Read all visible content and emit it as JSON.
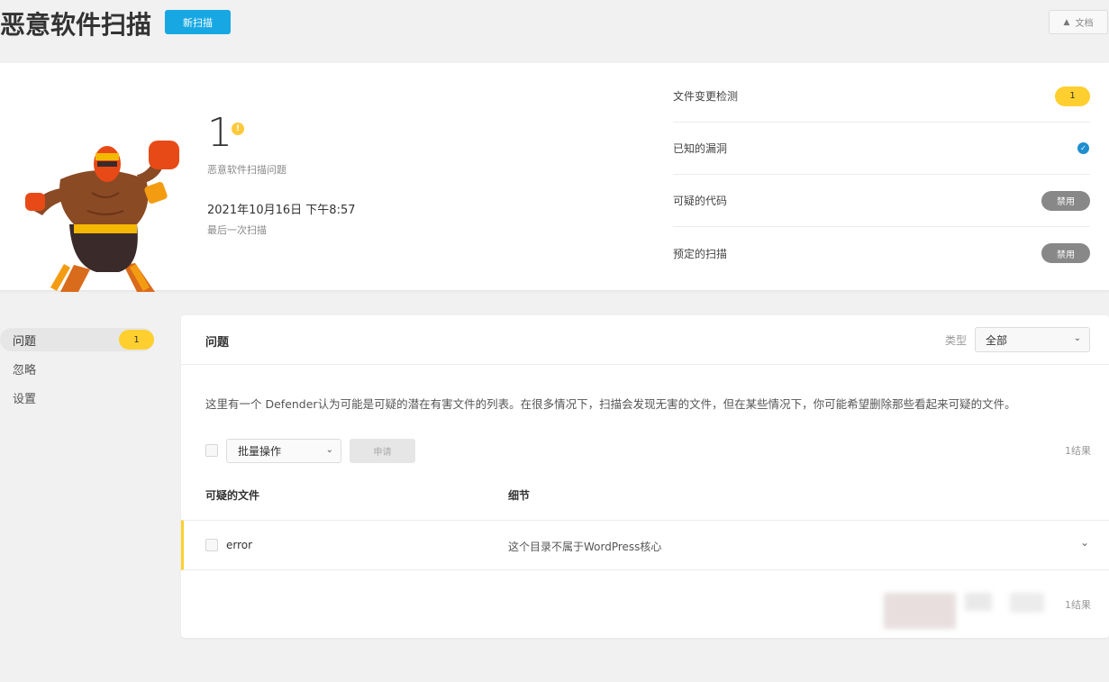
{
  "header": {
    "title": "恶意软件扫描",
    "new_scan_label": "新扫描",
    "docs_label": "文档"
  },
  "summary": {
    "issue_count": "1",
    "info_badge": "!",
    "issue_label": "恶意软件扫描问题",
    "last_scan_date": "2021年10月16日 下午8:57",
    "last_scan_label": "最后一次扫描",
    "stats": [
      {
        "label": "文件变更检测",
        "value": "1",
        "kind": "count"
      },
      {
        "label": "已知的漏洞",
        "value": "✓",
        "kind": "check"
      },
      {
        "label": "可疑的代码",
        "value": "禁用",
        "kind": "disabled"
      },
      {
        "label": "预定的扫描",
        "value": "禁用",
        "kind": "disabled"
      }
    ]
  },
  "sidebar": {
    "items": [
      {
        "label": "问题",
        "badge": "1",
        "active": true
      },
      {
        "label": "忽略"
      },
      {
        "label": "设置"
      }
    ]
  },
  "issues": {
    "title": "问题",
    "type_label": "类型",
    "type_value": "全部",
    "description": "这里有一个 Defender认为可能是可疑的潜在有害文件的列表。在很多情况下，扫描会发现无害的文件，但在某些情况下，你可能希望删除那些看起来可疑的文件。",
    "bulk_action_label": "批量操作",
    "apply_label": "申请",
    "result_count_top": "1结果",
    "result_count_bottom": "1结果",
    "columns": {
      "file": "可疑的文件",
      "detail": "细节"
    },
    "rows": [
      {
        "file": "error",
        "detail": "这个目录不属于WordPress核心"
      }
    ]
  },
  "colors": {
    "accent_blue": "#17a8e3",
    "badge_yellow": "#fecf2f",
    "disabled_gray": "#888888",
    "check_blue": "#1e8fce"
  }
}
